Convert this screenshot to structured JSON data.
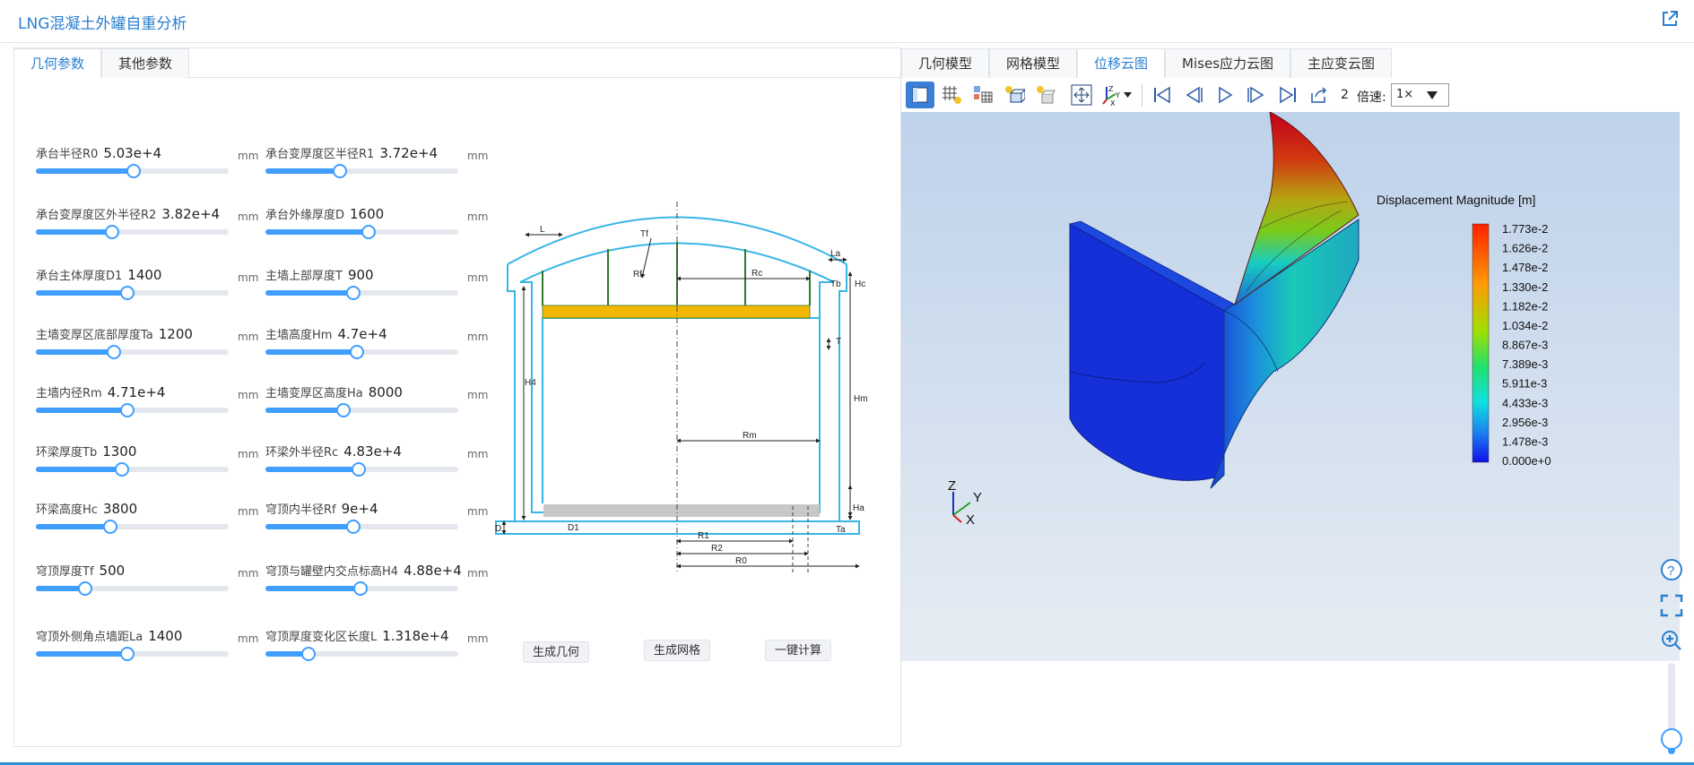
{
  "app": {
    "title": "LNG混凝土外罐自重分析"
  },
  "left_tabs": [
    {
      "label": "几何参数",
      "active": true
    },
    {
      "label": "其他参数",
      "active": false
    }
  ],
  "params": [
    {
      "label": "承台半径R0",
      "value": "5.03e+4",
      "unit": "mm",
      "level": 0.5
    },
    {
      "label": "承台变厚度区半径R1",
      "value": "3.72e+4",
      "unit": "mm",
      "level": 0.38
    },
    {
      "label": "承台变厚度区外半径R2",
      "value": "3.82e+4",
      "unit": "mm",
      "level": 0.39
    },
    {
      "label": "承台外缘厚度D",
      "value": "1600",
      "unit": "mm",
      "level": 0.53
    },
    {
      "label": "承台主体厚度D1",
      "value": "1400",
      "unit": "mm",
      "level": 0.47
    },
    {
      "label": "主墙上部厚度T",
      "value": "900",
      "unit": "mm",
      "level": 0.45
    },
    {
      "label": "主墙变厚区底部厚度Ta",
      "value": "1200",
      "unit": "mm",
      "level": 0.4
    },
    {
      "label": "主墙高度Hm",
      "value": "4.7e+4",
      "unit": "mm",
      "level": 0.47
    },
    {
      "label": "主墙内径Rm",
      "value": "4.71e+4",
      "unit": "mm",
      "level": 0.47
    },
    {
      "label": "主墙变厚区高度Ha",
      "value": "8000",
      "unit": "mm",
      "level": 0.4
    },
    {
      "label": "环梁厚度Tb",
      "value": "1300",
      "unit": "mm",
      "level": 0.44
    },
    {
      "label": "环梁外半径Rc",
      "value": "4.83e+4",
      "unit": "mm",
      "level": 0.48
    },
    {
      "label": "环梁高度Hc",
      "value": "3800",
      "unit": "mm",
      "level": 0.38
    },
    {
      "label": "穹顶内半径Rf",
      "value": "9e+4",
      "unit": "mm",
      "level": 0.45
    },
    {
      "label": "穹顶厚度Tf",
      "value": "500",
      "unit": "mm",
      "level": 0.25
    },
    {
      "label": "穹顶与罐壁内交点标高H4",
      "value": "4.88e+4",
      "unit": "mm",
      "level": 0.49
    },
    {
      "label": "穹顶外侧角点墙距La",
      "value": "1400",
      "unit": "mm",
      "level": 0.47
    },
    {
      "label": "穹顶厚度变化区长度L",
      "value": "1.318e+4",
      "unit": "mm",
      "level": 0.22
    }
  ],
  "diagram_labels": {
    "L": "L",
    "Tf": "Tf",
    "La": "La",
    "Rf": "Rf",
    "Rc": "Rc",
    "Tb": "Tb",
    "Hc": "Hc",
    "T": "T",
    "H4": "H4",
    "Hm": "Hm",
    "Rm": "Rm",
    "Ha": "Ha",
    "D": "D",
    "D1": "D1",
    "Ta": "Ta",
    "R1": "R1",
    "R2": "R2",
    "R0": "R0"
  },
  "buttons": {
    "gen_geometry": "生成几何",
    "gen_mesh": "生成网格",
    "one_click": "一键计算"
  },
  "right_tabs": [
    {
      "label": "几何模型",
      "active": false
    },
    {
      "label": "网格模型",
      "active": false
    },
    {
      "label": "位移云图",
      "active": true
    },
    {
      "label": "Mises应力云图",
      "active": false
    },
    {
      "label": "主应变云图",
      "active": false
    }
  ],
  "toolbar": {
    "frame": "2",
    "speed_label": "倍速:",
    "speed_value": "1×"
  },
  "legend": {
    "title": "Displacement Magnitude [m]",
    "ticks": [
      "1.773e-2",
      "1.626e-2",
      "1.478e-2",
      "1.330e-2",
      "1.182e-2",
      "1.034e-2",
      "8.867e-3",
      "7.389e-3",
      "5.911e-3",
      "4.433e-3",
      "2.956e-3",
      "1.478e-3",
      "0.000e+0"
    ]
  },
  "triad": {
    "z": "Z",
    "y": "Y",
    "x": "X"
  },
  "zoom_level": 0.15,
  "colors": {
    "accent": "#2b7fd0",
    "slider": "#409eff",
    "diagram": "#38b6e6"
  }
}
